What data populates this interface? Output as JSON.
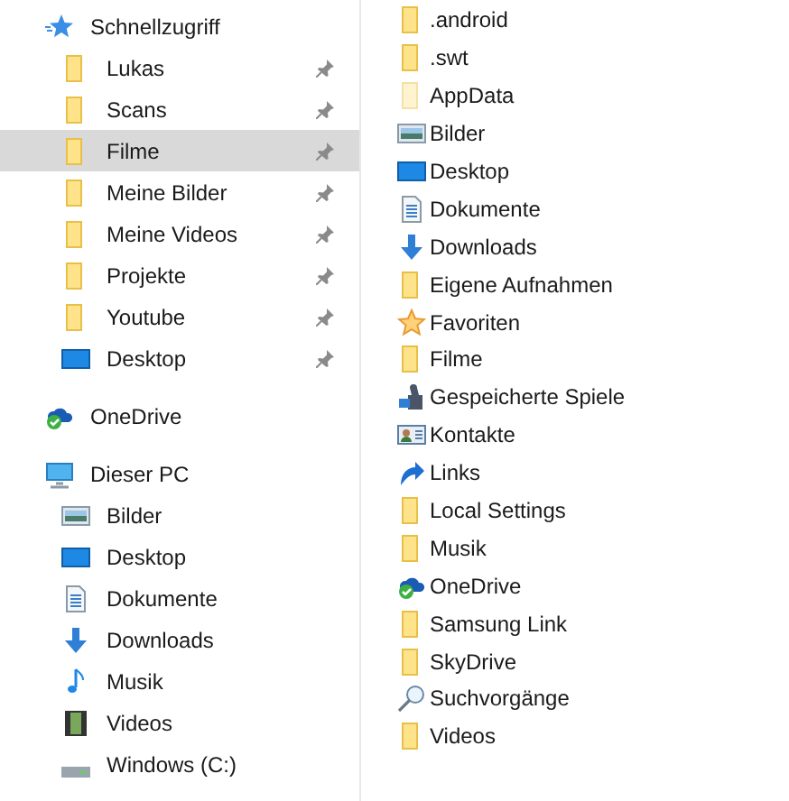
{
  "navigation_pane": {
    "items": [
      {
        "label": "Schnellzugriff",
        "kind": "quick-access",
        "selected": false
      },
      {
        "label": "Lukas",
        "kind": "folder",
        "pinned": true,
        "selected": false
      },
      {
        "label": "Scans",
        "kind": "folder",
        "pinned": true,
        "selected": false
      },
      {
        "label": "Filme",
        "kind": "folder",
        "pinned": true,
        "selected": true
      },
      {
        "label": "Meine Bilder",
        "kind": "folder",
        "pinned": true,
        "selected": false
      },
      {
        "label": "Meine Videos",
        "kind": "folder",
        "pinned": true,
        "selected": false
      },
      {
        "label": "Projekte",
        "kind": "folder",
        "pinned": true,
        "selected": false
      },
      {
        "label": "Youtube",
        "kind": "folder",
        "pinned": true,
        "selected": false
      },
      {
        "label": "Desktop",
        "kind": "desktop",
        "pinned": true,
        "selected": false
      },
      {
        "label": "OneDrive",
        "kind": "onedrive",
        "selected": false
      },
      {
        "label": "Dieser PC",
        "kind": "pc",
        "selected": false
      },
      {
        "label": "Bilder",
        "kind": "pictures",
        "selected": false
      },
      {
        "label": "Desktop",
        "kind": "desktop",
        "selected": false
      },
      {
        "label": "Dokumente",
        "kind": "documents",
        "selected": false
      },
      {
        "label": "Downloads",
        "kind": "downloads",
        "selected": false
      },
      {
        "label": "Musik",
        "kind": "music",
        "selected": false
      },
      {
        "label": "Videos",
        "kind": "videos",
        "selected": false
      },
      {
        "label": "Windows (C:)",
        "kind": "drive",
        "selected": false
      }
    ]
  },
  "file_list": {
    "items": [
      {
        "label": ".android",
        "kind": "folder"
      },
      {
        "label": ".swt",
        "kind": "folder"
      },
      {
        "label": "AppData",
        "kind": "hidden-folder"
      },
      {
        "label": "Bilder",
        "kind": "pictures"
      },
      {
        "label": "Desktop",
        "kind": "desktop"
      },
      {
        "label": "Dokumente",
        "kind": "documents"
      },
      {
        "label": "Downloads",
        "kind": "downloads"
      },
      {
        "label": "Eigene Aufnahmen",
        "kind": "folder"
      },
      {
        "label": "Favoriten",
        "kind": "favorites"
      },
      {
        "label": "Filme",
        "kind": "folder"
      },
      {
        "label": "Gespeicherte Spiele",
        "kind": "games"
      },
      {
        "label": "Kontakte",
        "kind": "contacts"
      },
      {
        "label": "Links",
        "kind": "links"
      },
      {
        "label": "Local Settings",
        "kind": "folder"
      },
      {
        "label": "Musik",
        "kind": "folder"
      },
      {
        "label": "OneDrive",
        "kind": "onedrive"
      },
      {
        "label": "Samsung Link",
        "kind": "folder"
      },
      {
        "label": "SkyDrive",
        "kind": "folder"
      },
      {
        "label": "Suchvorgänge",
        "kind": "search"
      },
      {
        "label": "Videos",
        "kind": "folder"
      }
    ]
  }
}
